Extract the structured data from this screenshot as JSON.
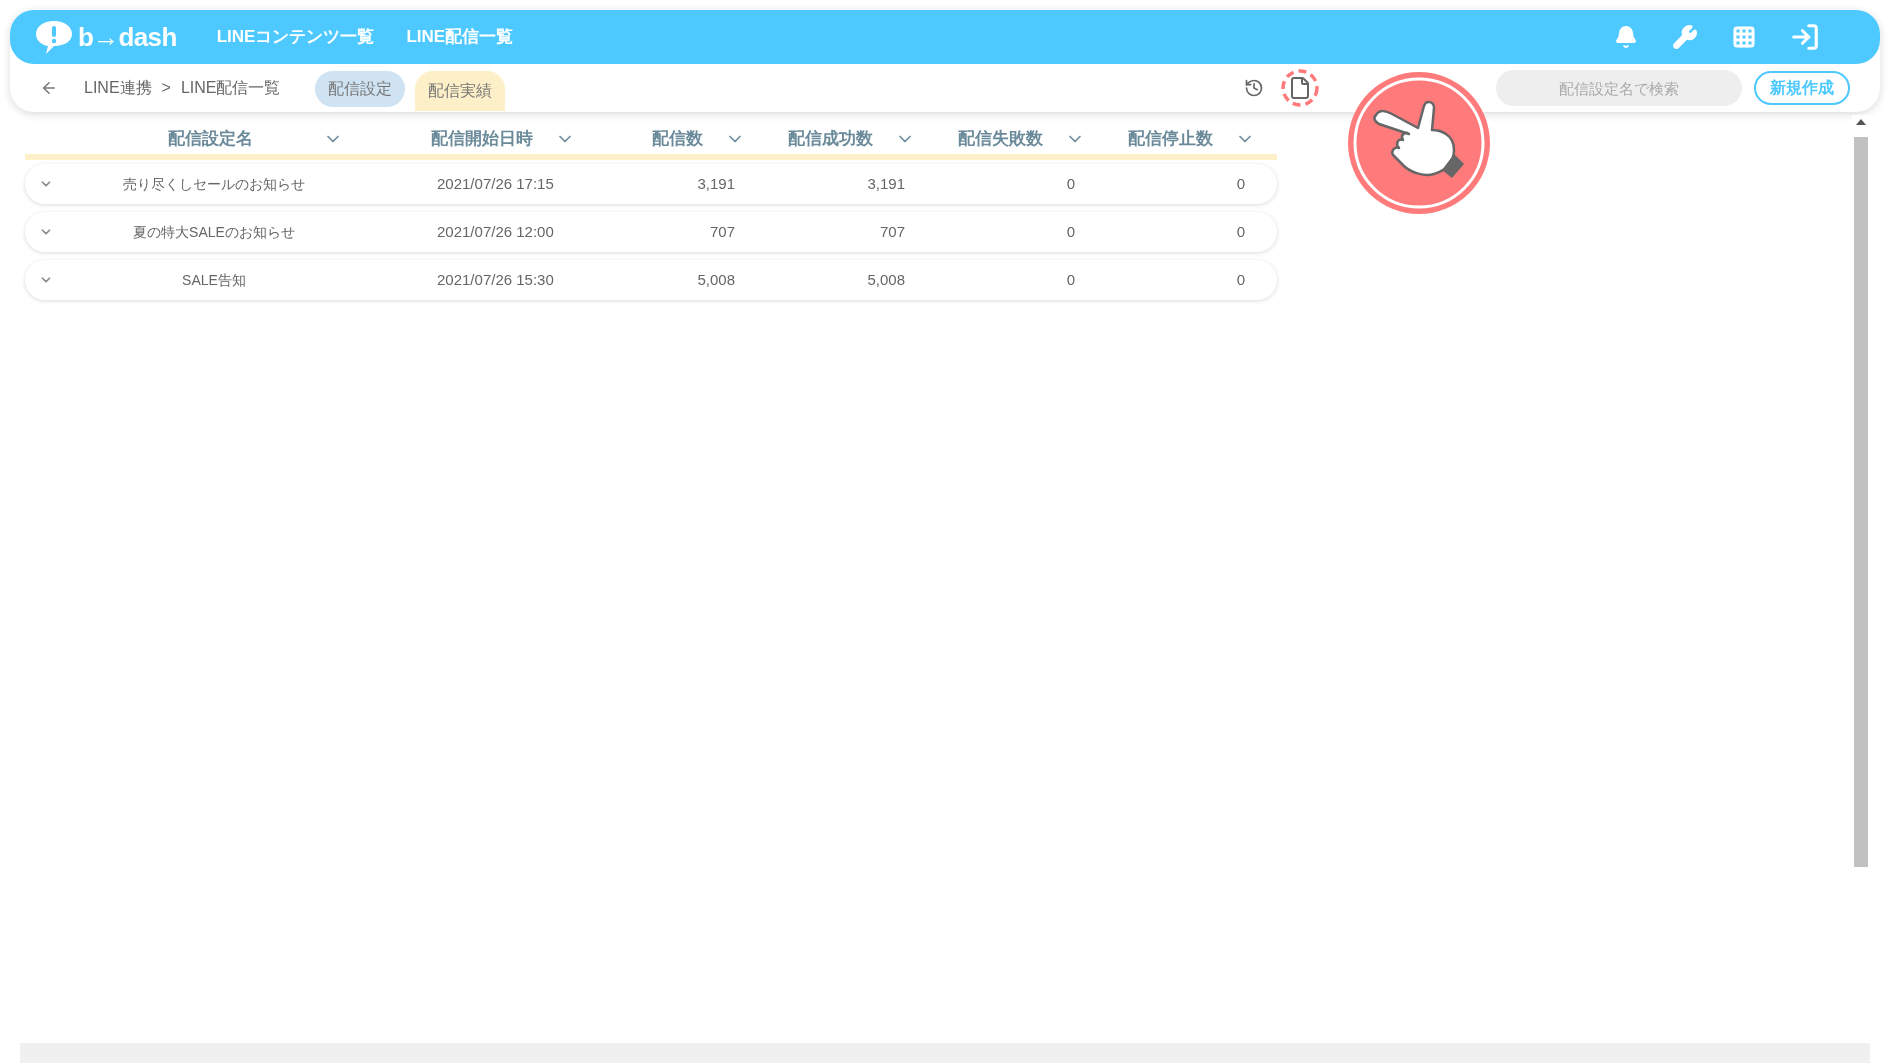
{
  "header": {
    "logo": "b→dash",
    "nav": [
      {
        "label": "LINEコンテンツ一覧"
      },
      {
        "label": "LINE配信一覧"
      }
    ]
  },
  "subbar": {
    "breadcrumb": [
      "LINE連携",
      ">",
      "LINE配信一覧"
    ],
    "tabs": [
      {
        "label": "配信設定",
        "selected": false
      },
      {
        "label": "配信実績",
        "selected": true
      }
    ],
    "search": {
      "placeholder": "配信設定名で検索"
    },
    "new_button": "新規作成"
  },
  "table": {
    "columns": [
      "配信設定名",
      "配信開始日時",
      "配信数",
      "配信成功数",
      "配信失敗数",
      "配信停止数"
    ],
    "rows": [
      {
        "cells": [
          "売り尽くしセールのお知らせ",
          "2021/07/26 17:15",
          "3,191",
          "3,191",
          "0",
          "0"
        ]
      },
      {
        "cells": [
          "夏の特大SALEのお知らせ",
          "2021/07/26 12:00",
          "707",
          "707",
          "0",
          "0"
        ]
      },
      {
        "cells": [
          "SALE告知",
          "2021/07/26 15:30",
          "5,008",
          "5,008",
          "0",
          "0"
        ]
      }
    ]
  }
}
